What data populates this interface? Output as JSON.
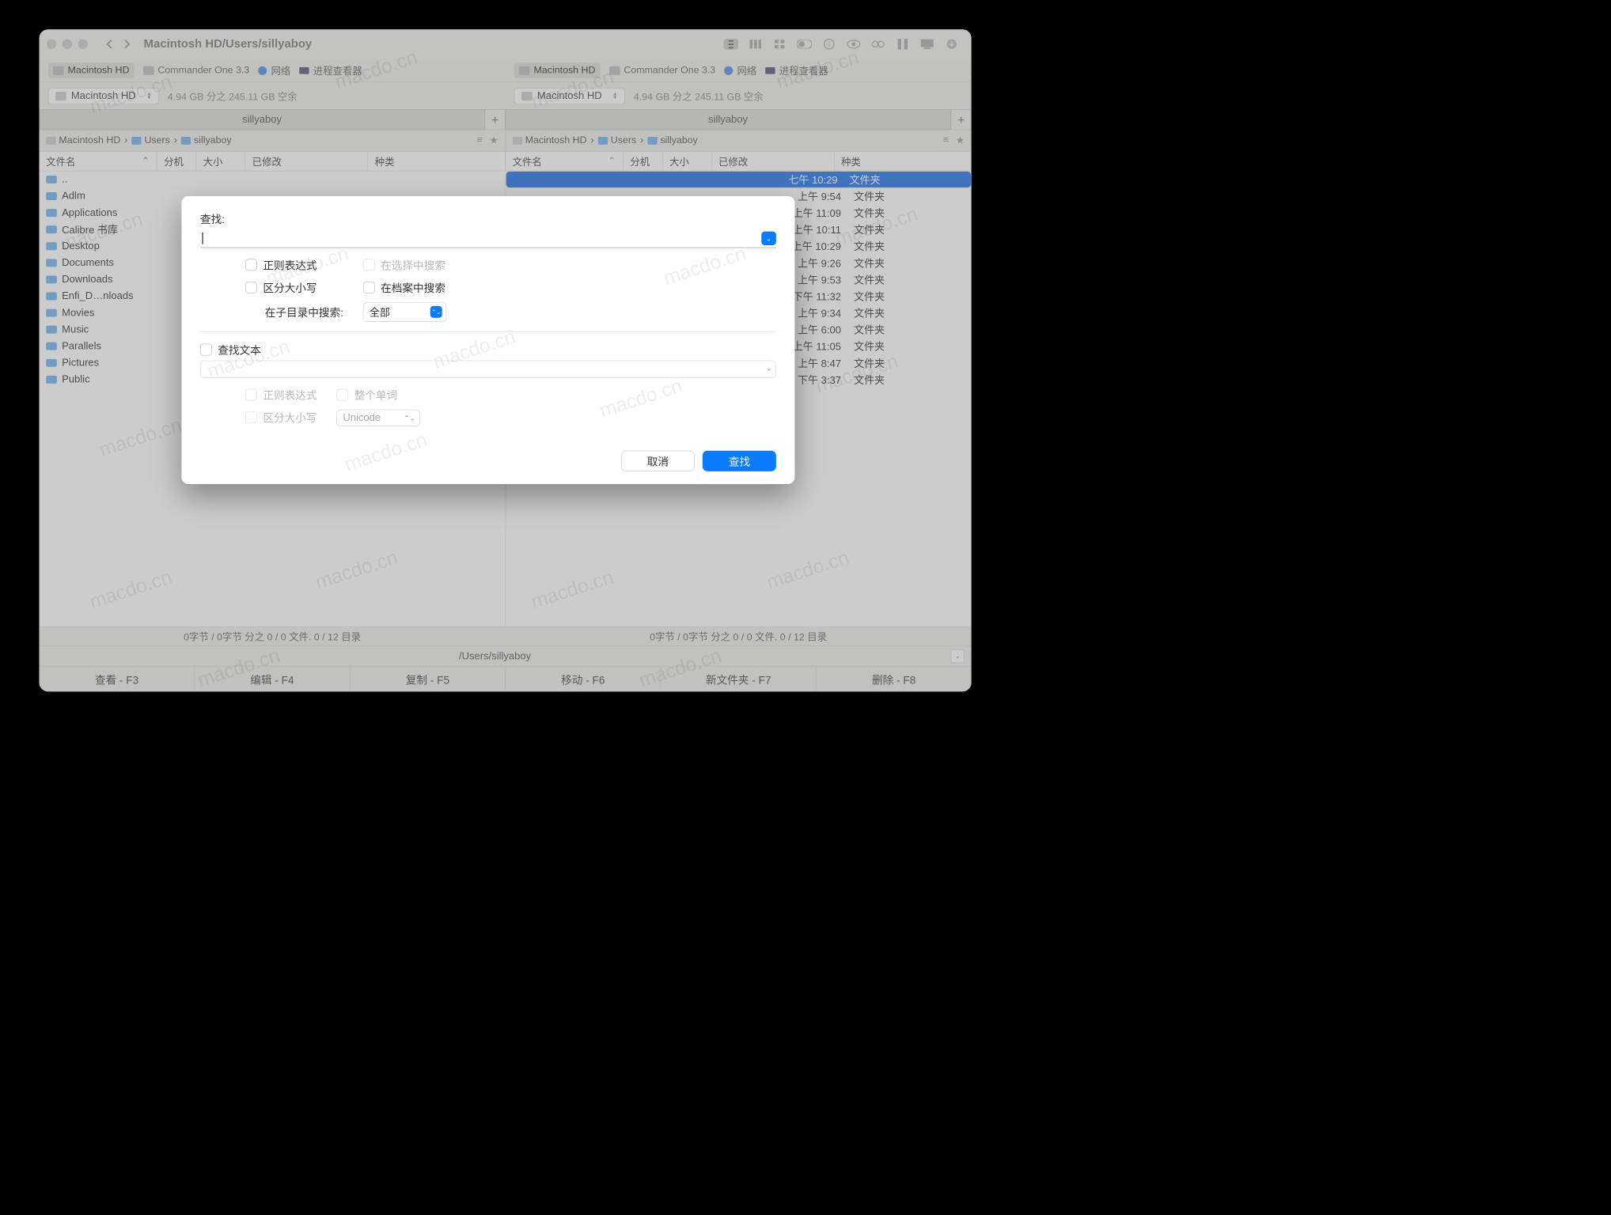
{
  "title": "Macintosh HD/Users/sillyaboy",
  "source_tabs": [
    "Macintosh HD",
    "Commander One 3.3",
    "网络",
    "进程查看器"
  ],
  "drive": {
    "name": "Macintosh HD",
    "space": "4.94 GB 分之 245.11 GB 空余"
  },
  "tab_label": "sillyaboy",
  "breadcrumb": [
    "Macintosh HD",
    "Users",
    "sillyaboy"
  ],
  "columns": {
    "name": "文件名",
    "ext": "分机",
    "size": "大小",
    "mod": "已修改",
    "kind": "种类"
  },
  "left_files": [
    {
      "name": "..",
      "kind": ""
    },
    {
      "name": "Adlm",
      "kind": ""
    },
    {
      "name": "Applications",
      "kind": ""
    },
    {
      "name": "Calibre 书库",
      "kind": ""
    },
    {
      "name": "Desktop",
      "kind": ""
    },
    {
      "name": "Documents",
      "kind": ""
    },
    {
      "name": "Downloads",
      "kind": ""
    },
    {
      "name": "Enfi_D…nloads",
      "kind": ""
    },
    {
      "name": "Movies",
      "kind": ""
    },
    {
      "name": "Music",
      "kind": ""
    },
    {
      "name": "Parallels",
      "kind": ""
    },
    {
      "name": "Pictures",
      "kind": ""
    },
    {
      "name": "Public",
      "kind": ""
    }
  ],
  "right_rows": [
    {
      "mod": "七午 10:29",
      "kind": "文件夹",
      "sel": true
    },
    {
      "mod": "上午 9:54",
      "kind": "文件夹"
    },
    {
      "mod": "上午 11:09",
      "kind": "文件夹"
    },
    {
      "mod": "上午 10:11",
      "kind": "文件夹"
    },
    {
      "mod": "上午 10:29",
      "kind": "文件夹"
    },
    {
      "mod": "上午 9:26",
      "kind": "文件夹"
    },
    {
      "mod": "上午 9:53",
      "kind": "文件夹"
    },
    {
      "mod": "下午 11:32",
      "kind": "文件夹"
    },
    {
      "mod": "上午 9:34",
      "kind": "文件夹"
    },
    {
      "mod": "上午 6:00",
      "kind": "文件夹"
    },
    {
      "mod": "上午 11:05",
      "kind": "文件夹"
    },
    {
      "mod": "上午 8:47",
      "kind": "文件夹"
    },
    {
      "mod": "下午 3:37",
      "kind": "文件夹"
    }
  ],
  "status": "0字节 / 0字节 分之 0 / 0 文件. 0 / 12 目录",
  "footer_path": "/Users/sillyaboy",
  "fkeys": [
    "查看 - F3",
    "编辑 - F4",
    "复制 - F5",
    "移动 - F6",
    "新文件夹 - F7",
    "删除 - F8"
  ],
  "dialog": {
    "find_label": "查找:",
    "opts": {
      "regex": "正则表达式",
      "case": "区分大小写",
      "in_selection": "在选择中搜索",
      "in_archive": "在档案中搜索",
      "subdir_label": "在子目录中搜索:",
      "subdir_value": "全部",
      "find_text": "查找文本",
      "regex2": "正则表达式",
      "case2": "区分大小写",
      "whole_word": "整个单词",
      "encoding": "Unicode"
    },
    "cancel": "取消",
    "ok": "查找"
  },
  "watermark": "macdo.cn"
}
